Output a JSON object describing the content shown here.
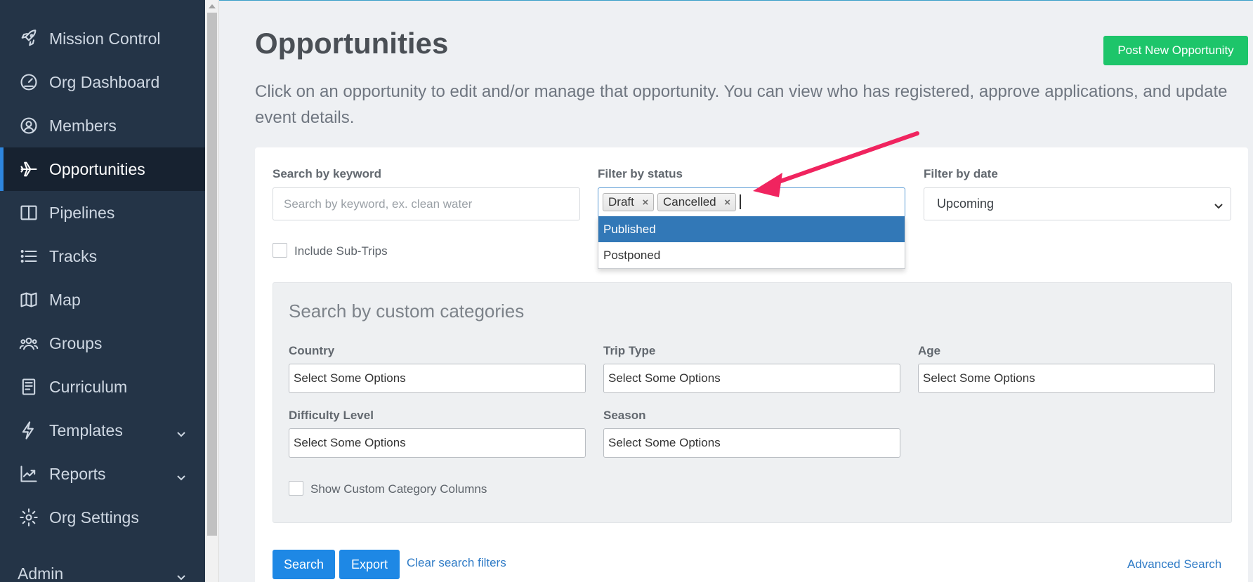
{
  "sidebar": {
    "items": [
      {
        "label": "Mission Control",
        "icon": "rocket-icon"
      },
      {
        "label": "Org Dashboard",
        "icon": "dashboard-gauge-icon"
      },
      {
        "label": "Members",
        "icon": "user-circle-icon"
      },
      {
        "label": "Opportunities",
        "icon": "plane-icon",
        "active": true
      },
      {
        "label": "Pipelines",
        "icon": "columns-icon"
      },
      {
        "label": "Tracks",
        "icon": "list-icon"
      },
      {
        "label": "Map",
        "icon": "map-icon"
      },
      {
        "label": "Groups",
        "icon": "users-icon"
      },
      {
        "label": "Curriculum",
        "icon": "book-icon"
      },
      {
        "label": "Templates",
        "icon": "bolt-icon",
        "expandable": true
      },
      {
        "label": "Reports",
        "icon": "chart-line-icon",
        "expandable": true
      },
      {
        "label": "Org Settings",
        "icon": "gear-icon"
      },
      {
        "label": "Admin",
        "icon": "",
        "expandable": true
      }
    ]
  },
  "header": {
    "title": "Opportunities",
    "post_button": "Post New Opportunity",
    "description": "Click on an opportunity to edit and/or manage that opportunity. You can view who has registered, approve applications, and update event details."
  },
  "filters": {
    "keyword_label": "Search by keyword",
    "keyword_placeholder": "Search by keyword, ex. clean water",
    "status_label": "Filter by status",
    "status_selected": [
      "Draft",
      "Cancelled"
    ],
    "status_options": [
      "Published",
      "Postponed"
    ],
    "date_label": "Filter by date",
    "date_value": "Upcoming",
    "include_subtrips": "Include Sub-Trips"
  },
  "custom_categories": {
    "title": "Search by custom categories",
    "fields": [
      {
        "label": "Country",
        "placeholder": "Select Some Options"
      },
      {
        "label": "Trip Type",
        "placeholder": "Select Some Options"
      },
      {
        "label": "Age",
        "placeholder": "Select Some Options"
      },
      {
        "label": "Difficulty Level",
        "placeholder": "Select Some Options"
      },
      {
        "label": "Season",
        "placeholder": "Select Some Options"
      }
    ],
    "show_columns": "Show Custom Category Columns"
  },
  "actions": {
    "search": "Search",
    "export": "Export",
    "clear": "Clear search filters",
    "advanced": "Advanced Search"
  },
  "colors": {
    "sidebar_bg": "#243447",
    "accent_green": "#1dc56a",
    "accent_blue": "#1e88e5",
    "highlight": "#3278b7",
    "annotation_arrow": "#f0245f"
  }
}
